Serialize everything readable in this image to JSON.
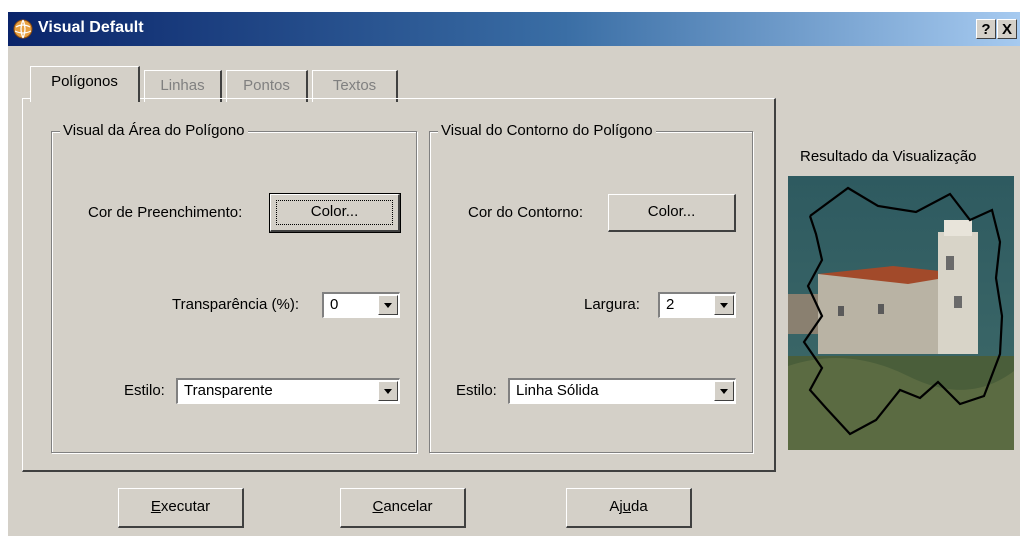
{
  "window": {
    "title": "Visual Default",
    "help_glyph": "?",
    "close_glyph": "X"
  },
  "tabs": [
    {
      "label": "Polígonos",
      "active": true
    },
    {
      "label": "Linhas",
      "active": false
    },
    {
      "label": "Pontos",
      "active": false
    },
    {
      "label": "Textos",
      "active": false
    }
  ],
  "area_group": {
    "title": "Visual da Área do Polígono",
    "fill_color_label": "Cor de Preenchimento:",
    "fill_color_button": "Color...",
    "transparency_label": "Transparência (%):",
    "transparency_value": "0",
    "style_label": "Estilo:",
    "style_value": "Transparente"
  },
  "contour_group": {
    "title": "Visual do Contorno do Polígono",
    "contour_color_label": "Cor do Contorno:",
    "contour_color_button": "Color...",
    "width_label": "Largura:",
    "width_value": "2",
    "style_label": "Estilo:",
    "style_value": "Linha Sólida"
  },
  "preview": {
    "label": "Resultado da Visualização"
  },
  "buttons": {
    "execute": {
      "mnemonic": "E",
      "rest": "xecutar"
    },
    "cancel": {
      "mnemonic": "C",
      "rest": "ancelar"
    },
    "help": {
      "pre": "Aj",
      "mnemonic": "u",
      "rest": "da"
    }
  },
  "colors": {
    "dialog_bg": "#d4d0c8",
    "title_start": "#0a246a",
    "title_end": "#a6caf0"
  }
}
